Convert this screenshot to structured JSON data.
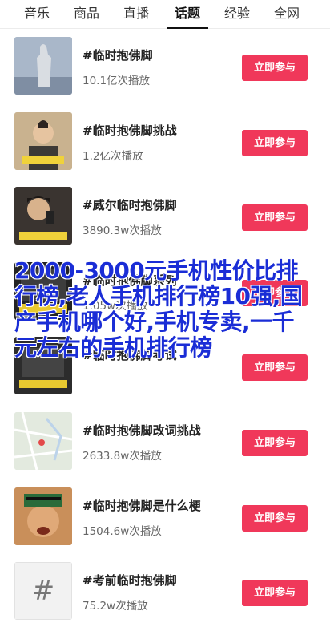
{
  "tabs": [
    {
      "label": "音乐",
      "active": false
    },
    {
      "label": "商品",
      "active": false
    },
    {
      "label": "直播",
      "active": false
    },
    {
      "label": "话题",
      "active": true
    },
    {
      "label": "经验",
      "active": false
    },
    {
      "label": "全网",
      "active": false
    }
  ],
  "colors": {
    "accent": "#f0385a",
    "overlay": "#1a2dd6"
  },
  "join_label": "立即参与",
  "topics": [
    {
      "title": "#临时抱佛脚",
      "count": "10.1亿次播放",
      "thumb": "statue"
    },
    {
      "title": "#临时抱佛脚挑战",
      "count": "1.2亿次播放",
      "thumb": "person"
    },
    {
      "title": "#威尔临时抱佛脚",
      "count": "3890.3w次播放",
      "thumb": "singer"
    },
    {
      "title": "#临时抱佛脚系列",
      "count": "1.05w次播放",
      "thumb": "dark"
    },
    {
      "title": "#临时抱佛脚考试",
      "count": "",
      "thumb": "dark2"
    },
    {
      "title": "#临时抱佛脚改词挑战",
      "count": "2633.8w次播放",
      "thumb": "map"
    },
    {
      "title": "#临时抱佛脚是什么梗",
      "count": "1504.6w次播放",
      "thumb": "face"
    },
    {
      "title": "#考前临时抱佛脚",
      "count": "75.2w次播放",
      "thumb": "hash",
      "thumb_text": "#"
    }
  ],
  "overlay_text": "2000-3000元手机性价比排行榜,老人手机排行榜10强,国产手机哪个好,手机专卖,一千元左右的手机排行榜"
}
